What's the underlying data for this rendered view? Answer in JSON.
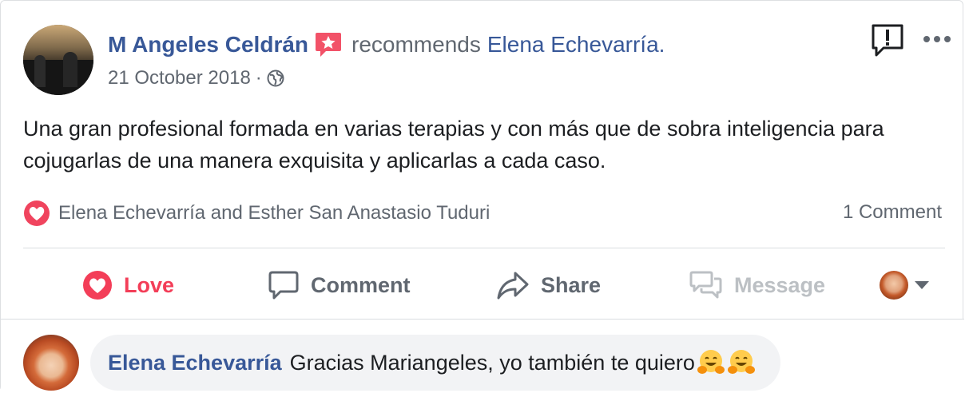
{
  "post": {
    "author": "M Angeles Celdrán",
    "recommends_text": "recommends",
    "page_name": "Elena Echevarría",
    "period": ".",
    "date": "21 October 2018",
    "separator": "·",
    "privacy_icon": "globe-icon",
    "text": "Una gran profesional formada en varias terapias y con más que de sobra inteligencia para cojugarlas de una manera exquisita y aplicarlas a cada caso."
  },
  "reactions": {
    "icon": "love-reaction-icon",
    "names": "Elena Echevarría and Esther San Anastasio Tuduri",
    "comment_count": "1 Comment"
  },
  "actions": {
    "love": "Love",
    "comment": "Comment",
    "share": "Share",
    "message": "Message"
  },
  "comment": {
    "author": "Elena Echevarría",
    "text": "Gracias Mariangeles, yo también te quiero",
    "emoji": [
      "hugging-face",
      "hugging-face"
    ]
  },
  "colors": {
    "link": "#385898",
    "love": "#f33e58",
    "muted": "#606770",
    "disabled": "#bcc0c4",
    "recommend_badge": "#f25268"
  }
}
